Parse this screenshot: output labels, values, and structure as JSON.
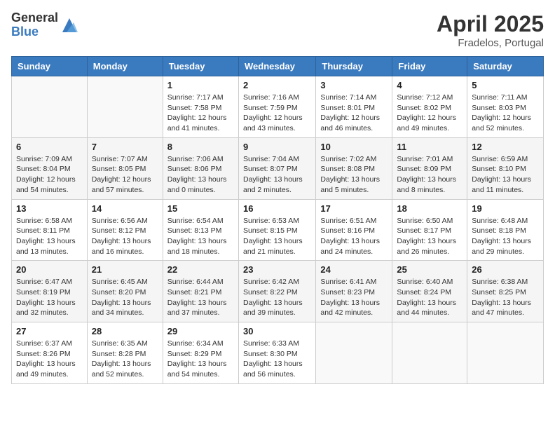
{
  "header": {
    "logo_general": "General",
    "logo_blue": "Blue",
    "month_year": "April 2025",
    "location": "Fradelos, Portugal"
  },
  "days_of_week": [
    "Sunday",
    "Monday",
    "Tuesday",
    "Wednesday",
    "Thursday",
    "Friday",
    "Saturday"
  ],
  "weeks": [
    [
      {
        "day": "",
        "info": ""
      },
      {
        "day": "",
        "info": ""
      },
      {
        "day": "1",
        "info": "Sunrise: 7:17 AM\nSunset: 7:58 PM\nDaylight: 12 hours and 41 minutes."
      },
      {
        "day": "2",
        "info": "Sunrise: 7:16 AM\nSunset: 7:59 PM\nDaylight: 12 hours and 43 minutes."
      },
      {
        "day": "3",
        "info": "Sunrise: 7:14 AM\nSunset: 8:01 PM\nDaylight: 12 hours and 46 minutes."
      },
      {
        "day": "4",
        "info": "Sunrise: 7:12 AM\nSunset: 8:02 PM\nDaylight: 12 hours and 49 minutes."
      },
      {
        "day": "5",
        "info": "Sunrise: 7:11 AM\nSunset: 8:03 PM\nDaylight: 12 hours and 52 minutes."
      }
    ],
    [
      {
        "day": "6",
        "info": "Sunrise: 7:09 AM\nSunset: 8:04 PM\nDaylight: 12 hours and 54 minutes."
      },
      {
        "day": "7",
        "info": "Sunrise: 7:07 AM\nSunset: 8:05 PM\nDaylight: 12 hours and 57 minutes."
      },
      {
        "day": "8",
        "info": "Sunrise: 7:06 AM\nSunset: 8:06 PM\nDaylight: 13 hours and 0 minutes."
      },
      {
        "day": "9",
        "info": "Sunrise: 7:04 AM\nSunset: 8:07 PM\nDaylight: 13 hours and 2 minutes."
      },
      {
        "day": "10",
        "info": "Sunrise: 7:02 AM\nSunset: 8:08 PM\nDaylight: 13 hours and 5 minutes."
      },
      {
        "day": "11",
        "info": "Sunrise: 7:01 AM\nSunset: 8:09 PM\nDaylight: 13 hours and 8 minutes."
      },
      {
        "day": "12",
        "info": "Sunrise: 6:59 AM\nSunset: 8:10 PM\nDaylight: 13 hours and 11 minutes."
      }
    ],
    [
      {
        "day": "13",
        "info": "Sunrise: 6:58 AM\nSunset: 8:11 PM\nDaylight: 13 hours and 13 minutes."
      },
      {
        "day": "14",
        "info": "Sunrise: 6:56 AM\nSunset: 8:12 PM\nDaylight: 13 hours and 16 minutes."
      },
      {
        "day": "15",
        "info": "Sunrise: 6:54 AM\nSunset: 8:13 PM\nDaylight: 13 hours and 18 minutes."
      },
      {
        "day": "16",
        "info": "Sunrise: 6:53 AM\nSunset: 8:15 PM\nDaylight: 13 hours and 21 minutes."
      },
      {
        "day": "17",
        "info": "Sunrise: 6:51 AM\nSunset: 8:16 PM\nDaylight: 13 hours and 24 minutes."
      },
      {
        "day": "18",
        "info": "Sunrise: 6:50 AM\nSunset: 8:17 PM\nDaylight: 13 hours and 26 minutes."
      },
      {
        "day": "19",
        "info": "Sunrise: 6:48 AM\nSunset: 8:18 PM\nDaylight: 13 hours and 29 minutes."
      }
    ],
    [
      {
        "day": "20",
        "info": "Sunrise: 6:47 AM\nSunset: 8:19 PM\nDaylight: 13 hours and 32 minutes."
      },
      {
        "day": "21",
        "info": "Sunrise: 6:45 AM\nSunset: 8:20 PM\nDaylight: 13 hours and 34 minutes."
      },
      {
        "day": "22",
        "info": "Sunrise: 6:44 AM\nSunset: 8:21 PM\nDaylight: 13 hours and 37 minutes."
      },
      {
        "day": "23",
        "info": "Sunrise: 6:42 AM\nSunset: 8:22 PM\nDaylight: 13 hours and 39 minutes."
      },
      {
        "day": "24",
        "info": "Sunrise: 6:41 AM\nSunset: 8:23 PM\nDaylight: 13 hours and 42 minutes."
      },
      {
        "day": "25",
        "info": "Sunrise: 6:40 AM\nSunset: 8:24 PM\nDaylight: 13 hours and 44 minutes."
      },
      {
        "day": "26",
        "info": "Sunrise: 6:38 AM\nSunset: 8:25 PM\nDaylight: 13 hours and 47 minutes."
      }
    ],
    [
      {
        "day": "27",
        "info": "Sunrise: 6:37 AM\nSunset: 8:26 PM\nDaylight: 13 hours and 49 minutes."
      },
      {
        "day": "28",
        "info": "Sunrise: 6:35 AM\nSunset: 8:28 PM\nDaylight: 13 hours and 52 minutes."
      },
      {
        "day": "29",
        "info": "Sunrise: 6:34 AM\nSunset: 8:29 PM\nDaylight: 13 hours and 54 minutes."
      },
      {
        "day": "30",
        "info": "Sunrise: 6:33 AM\nSunset: 8:30 PM\nDaylight: 13 hours and 56 minutes."
      },
      {
        "day": "",
        "info": ""
      },
      {
        "day": "",
        "info": ""
      },
      {
        "day": "",
        "info": ""
      }
    ]
  ]
}
